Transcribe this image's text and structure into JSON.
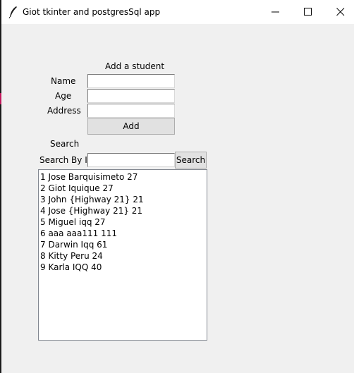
{
  "window": {
    "title": "Giot tkinter and postgresSql app",
    "icon": "feather-icon"
  },
  "form": {
    "heading": "Add a student",
    "name_label": "Name",
    "age_label": "Age",
    "address_label": "Address",
    "name_value": "",
    "age_value": "",
    "address_value": "",
    "add_button": "Add"
  },
  "search": {
    "heading": "Search",
    "id_label": "Search By ID",
    "id_value": "",
    "button": "Search"
  },
  "students": [
    "1 Jose Barquisimeto 27",
    "2 Giot Iquique 27",
    "3 John {Highway 21} 21",
    "4 Jose {Highway 21} 21",
    "5 Miguel iqq 27",
    "6 aaa aaa111 111",
    "7 Darwin Iqq 61",
    "8 Kitty Peru 24",
    "9 Karla IQQ 40"
  ]
}
